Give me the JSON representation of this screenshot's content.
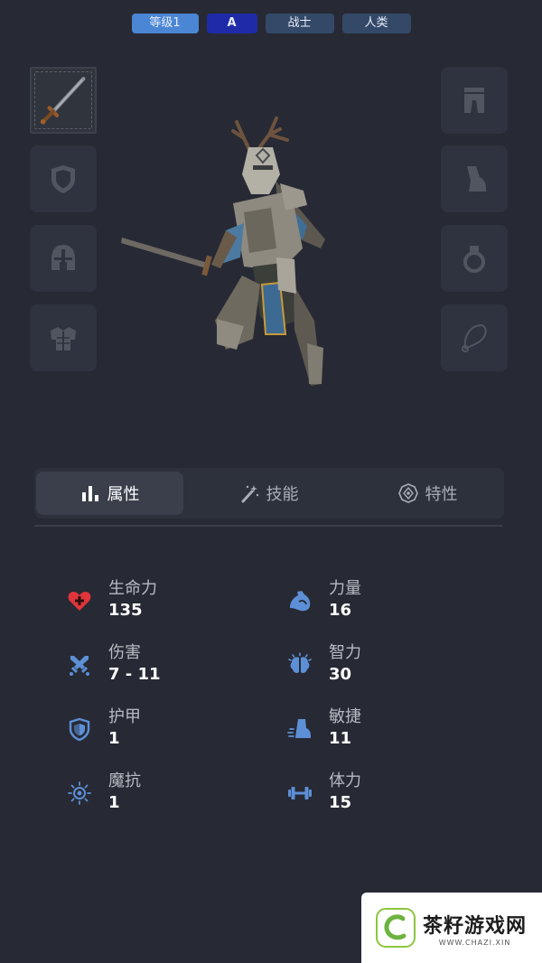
{
  "tags": {
    "level": "等级1",
    "grade": "A",
    "class": "战士",
    "race": "人类"
  },
  "equipment": {
    "left": [
      "sword-icon",
      "shield-icon",
      "helmet-icon",
      "chest-armor-icon"
    ],
    "right": [
      "pants-icon",
      "boot-icon",
      "ring-icon",
      "amulet-icon"
    ],
    "selected": "sword-icon"
  },
  "tabs": [
    {
      "label": "属性",
      "icon": "stats-bars-icon",
      "active": true
    },
    {
      "label": "技能",
      "icon": "magic-wand-icon",
      "active": false
    },
    {
      "label": "特性",
      "icon": "trait-emblem-icon",
      "active": false
    }
  ],
  "stats": {
    "left": [
      {
        "label": "生命力",
        "value": "135",
        "icon": "heart-icon"
      },
      {
        "label": "伤害",
        "value": "7 - 11",
        "icon": "crossed-swords-icon"
      },
      {
        "label": "护甲",
        "value": "1",
        "icon": "armor-shield-icon"
      },
      {
        "label": "魔抗",
        "value": "1",
        "icon": "magic-resist-icon"
      }
    ],
    "right": [
      {
        "label": "力量",
        "value": "16",
        "icon": "bicep-icon"
      },
      {
        "label": "智力",
        "value": "30",
        "icon": "brain-icon"
      },
      {
        "label": "敏捷",
        "value": "11",
        "icon": "boot-speed-icon"
      },
      {
        "label": "体力",
        "value": "15",
        "icon": "dumbbell-icon"
      }
    ]
  },
  "colors": {
    "background": "#272a34",
    "slot": "#2f333f",
    "icon_blue": "#5d8fd6",
    "heart_red": "#e0353b",
    "level_tag": "#4a86d4",
    "grade_tag": "#1f2aa8",
    "info_tag": "#344968"
  },
  "watermark": {
    "title": "茶籽游戏网",
    "subtitle": "WWW.CHAZI.XIN"
  }
}
